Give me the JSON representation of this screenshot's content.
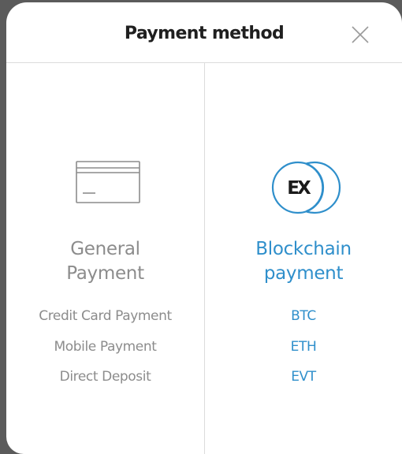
{
  "modal": {
    "title": "Payment method",
    "close_icon": "close-icon"
  },
  "general": {
    "icon": "credit-card-icon",
    "title_line1": "General",
    "title_line2": "Payment",
    "items": [
      "Credit Card Payment",
      "Mobile Payment",
      "Direct Deposit"
    ]
  },
  "blockchain": {
    "icon": "ex-logo-icon",
    "logo_text": "EX",
    "title_line1": "Blockchain",
    "title_line2": "payment",
    "items": [
      "BTC",
      "ETH",
      "EVT"
    ]
  },
  "colors": {
    "accent": "#2f8fcb",
    "muted": "#8c8c8c",
    "title": "#1f1f1f",
    "divider": "#dcdcdc",
    "backdrop": "#5b5b5b"
  }
}
